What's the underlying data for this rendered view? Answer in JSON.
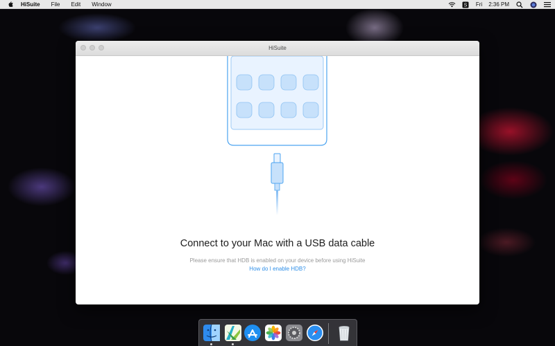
{
  "menubar": {
    "app_name": "HiSuite",
    "menus": [
      "File",
      "Edit",
      "Window"
    ],
    "clock_day": "Fri",
    "clock_time": "2:36 PM"
  },
  "window": {
    "title": "HiSuite",
    "connect_title": "Connect to your Mac with a USB data cable",
    "hint": "Please ensure that HDB is enabled on your device before using HiSuite",
    "help_link": "How do I enable HDB?"
  },
  "dock": {
    "apps": [
      {
        "name": "finder-icon",
        "running": true
      },
      {
        "name": "hisuite-icon",
        "running": true
      },
      {
        "name": "app-store-icon",
        "running": false
      },
      {
        "name": "photos-icon",
        "running": false
      },
      {
        "name": "system-preferences-icon",
        "running": false
      },
      {
        "name": "safari-icon",
        "running": false
      },
      {
        "name": "trash-icon",
        "running": false
      }
    ]
  },
  "colors": {
    "accent": "#2f8fe8",
    "illustration_stroke": "#4aa3f0",
    "illustration_fill": "#e9f3ff",
    "app_tile": "#c7e1fb"
  }
}
